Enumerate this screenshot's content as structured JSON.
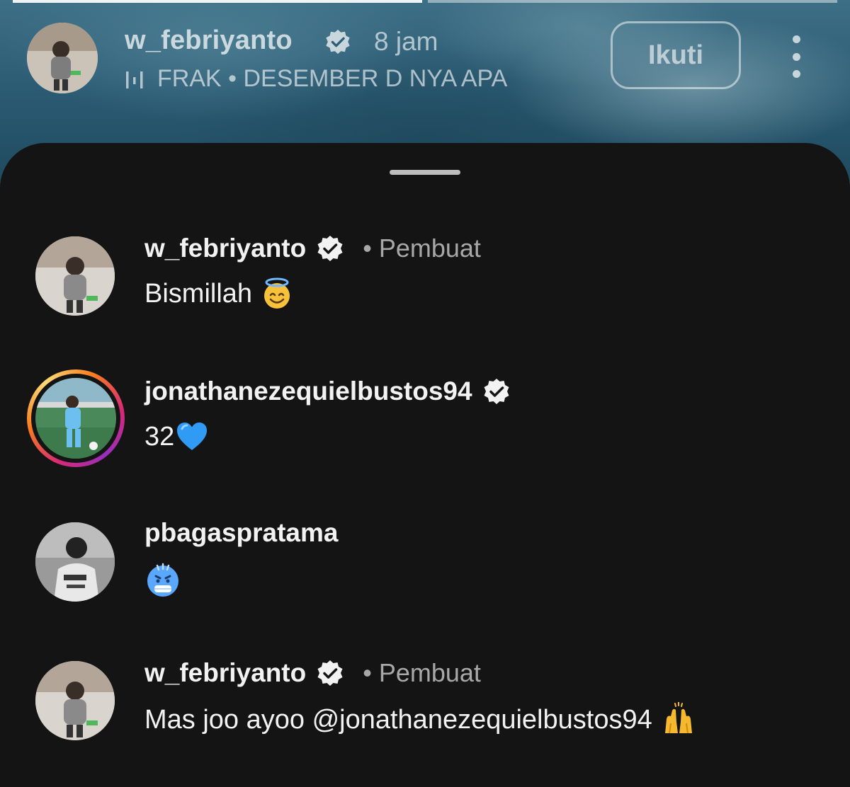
{
  "story": {
    "username": "w_febriyanto",
    "time": "8 jam",
    "music": "FRAK • DESEMBER D NYA APA",
    "follow_label": "Ikuti"
  },
  "comments": [
    {
      "username": "w_febriyanto",
      "verified": true,
      "role": "• Pembuat",
      "text": "Bismillah",
      "emoji": "smiling-face-with-halo"
    },
    {
      "username": "jonathanezequielbustos94",
      "verified": true,
      "role": "",
      "text": "32",
      "emoji": "blue-heart"
    },
    {
      "username": "pbagaspratama",
      "verified": false,
      "role": "",
      "text": "",
      "emoji": "cold-face"
    },
    {
      "username": "w_febriyanto",
      "verified": true,
      "role": "• Pembuat",
      "text": "Mas joo ayoo @jonathanezequielbustos94",
      "emoji": "raising-hands"
    }
  ],
  "colors": {
    "sheet_bg": "#141414",
    "text_primary": "#f2f2f2",
    "text_secondary": "#a8a8a8",
    "story_ring": "#d62976"
  }
}
